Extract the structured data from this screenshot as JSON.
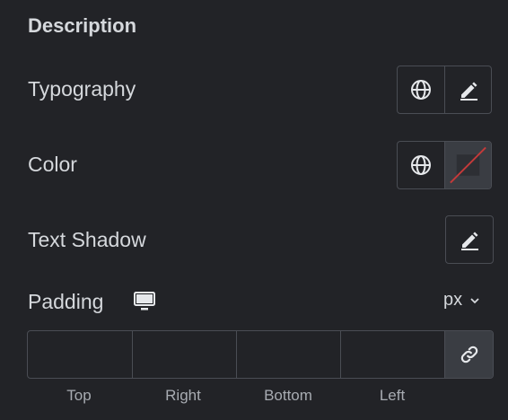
{
  "section": {
    "title": "Description"
  },
  "rows": {
    "typography": {
      "label": "Typography",
      "globals_icon": "globe-icon",
      "edit_icon": "pencil-icon"
    },
    "color": {
      "label": "Color",
      "globals_icon": "globe-icon",
      "swatch": "none"
    },
    "text_shadow": {
      "label": "Text Shadow",
      "edit_icon": "pencil-icon"
    },
    "padding": {
      "label": "Padding",
      "device_icon": "desktop-icon",
      "unit": "px",
      "unit_icon": "chevron-down-icon",
      "fields": [
        {
          "label": "Top",
          "value": ""
        },
        {
          "label": "Right",
          "value": ""
        },
        {
          "label": "Bottom",
          "value": ""
        },
        {
          "label": "Left",
          "value": ""
        }
      ],
      "link_icon": "link-icon"
    }
  },
  "colors": {
    "background": "#222327",
    "text": "#d5d8dc",
    "border": "#4a4d54",
    "button_alt": "#3a3d43",
    "no_color_slash": "#c43a3a"
  }
}
